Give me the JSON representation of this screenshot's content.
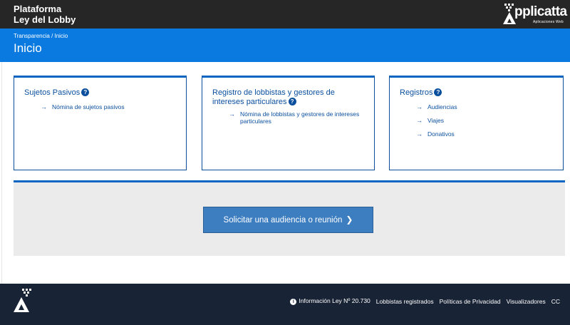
{
  "header": {
    "title_line1": "Plataforma",
    "title_line2": "Ley del Lobby",
    "logo_text": "pplicatta",
    "logo_sub": "Aplicaciones Web"
  },
  "subheader": {
    "breadcrumb": "Transparencia / Inicio",
    "page_title": "Inicio"
  },
  "cards": [
    {
      "title": "Sujetos Pasivos",
      "links": [
        "Nómina de sujetos pasivos"
      ]
    },
    {
      "title": "Registro de lobbistas y gestores de intereses particulares",
      "links": [
        "Nómina de lobbistas y gestores de intereses particulares"
      ]
    },
    {
      "title": "Registros",
      "links": [
        "Audiencias",
        "Viajes",
        "Donativos"
      ]
    }
  ],
  "cta": {
    "label": "Solicitar una audiencia o reunión"
  },
  "footer": {
    "links": [
      "Información Ley Nº 20.730",
      "Lobbistas registrados",
      "Políticas de Privacidad",
      "Visualizadores",
      "CC"
    ]
  },
  "icons": {
    "help": "question-circle-icon",
    "arrow": "arrow-right-icon",
    "info": "info-circle-icon",
    "chevron": "chevron-right-icon"
  },
  "colors": {
    "topbar": "#262626",
    "bluebar": "#0a7ae0",
    "card_border": "#0a64c2",
    "link": "#0a4f9e",
    "cta": "#3d7ec1",
    "panel": "#ebebeb",
    "footer": "#182335"
  }
}
